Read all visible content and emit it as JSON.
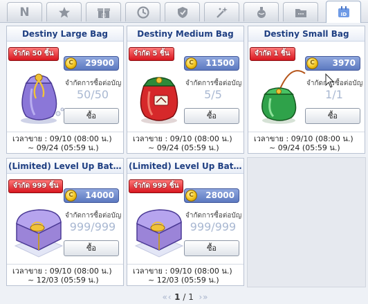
{
  "tabs": [
    {
      "label": "N",
      "icon": "new-icon"
    },
    {
      "icon": "star-icon"
    },
    {
      "icon": "gift-box-icon"
    },
    {
      "icon": "clock-icon"
    },
    {
      "icon": "shield-icon"
    },
    {
      "icon": "sparkle-wand-icon"
    },
    {
      "icon": "potion-icon"
    },
    {
      "icon": "folder-icon"
    },
    {
      "icon": "id-card-icon",
      "active": true
    }
  ],
  "items": [
    {
      "title": "Destiny Large Bag",
      "limit_ribbon": "จำกัด 50 ชิ้น",
      "price": "29900",
      "limit_label": "จำกัดการซื้อต่อบัญ",
      "limit_count": "50/50",
      "buy_label": "ซื้อ",
      "sale_line1": "เวลาขาย : 09/10 (08:00 น.)",
      "sale_line2": "~ 09/24 (05:59 น.)",
      "image": "purple-bag"
    },
    {
      "title": "Destiny Medium Bag",
      "limit_ribbon": "จำกัด 5 ชิ้น",
      "price": "11500",
      "limit_label": "จำกัดการซื้อต่อบัญ",
      "limit_count": "5/5",
      "buy_label": "ซื้อ",
      "sale_line1": "เวลาขาย : 09/10 (08:00 น.)",
      "sale_line2": "~ 09/24 (05:59 น.)",
      "image": "red-bag"
    },
    {
      "title": "Destiny Small Bag",
      "limit_ribbon": "จำกัด 1 ชิ้น",
      "price": "3970",
      "limit_label": "จำกัดการซื้อต่อบัญ",
      "limit_count": "1/1",
      "buy_label": "ซื้อ",
      "sale_line1": "เวลาขาย : 09/10 (08:00 น.)",
      "sale_line2": "~ 09/24 (05:59 น.)",
      "image": "green-bag"
    },
    {
      "title": "(Limited) Level Up Battle ...",
      "limit_ribbon": "จำกัด 999 ชิ้น",
      "price": "14000",
      "limit_label": "จำกัดการซื้อต่อบัญ",
      "limit_count": "999/999",
      "buy_label": "ซื้อ",
      "sale_line1": "เวลาขาย : 09/10 (08:00 น.)",
      "sale_line2": "~ 12/03 (05:59 น.)",
      "image": "purple-chest"
    },
    {
      "title": "(Limited) Level Up Battle ...",
      "limit_ribbon": "จำกัด 999 ชิ้น",
      "price": "28000",
      "limit_label": "จำกัดการซื้อต่อบัญ",
      "limit_count": "999/999",
      "buy_label": "ซื้อ",
      "sale_line1": "เวลาขาย : 09/10 (08:00 น.)",
      "sale_line2": "~ 12/03 (05:59 น.)",
      "image": "purple-chest"
    }
  ],
  "coin_symbol": "C",
  "pager": {
    "current": "1",
    "separator": "/",
    "total": "1",
    "first": "«",
    "prev": "‹",
    "next": "›",
    "last": "»"
  },
  "colors": {
    "title": "#1f3f82",
    "ribbon": "#d8151e",
    "price_box": "#5c79c0",
    "coin": "#f3c41b"
  }
}
